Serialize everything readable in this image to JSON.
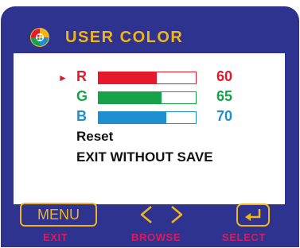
{
  "osd": {
    "title": "USER COLOR",
    "icon": "color-palette-icon"
  },
  "channels": [
    {
      "label": "R",
      "value": "60",
      "fraction": 0.6,
      "color": "#e5192b",
      "selected": true
    },
    {
      "label": "G",
      "value": "65",
      "fraction": 0.65,
      "color": "#17a24a",
      "selected": false
    },
    {
      "label": "B",
      "value": "70",
      "fraction": 0.7,
      "color": "#1e90d0",
      "selected": false
    }
  ],
  "menu_items": {
    "reset": "Reset",
    "exit_without_save": "EXIT WITHOUT SAVE"
  },
  "pointer_glyph": "►",
  "footer": {
    "menu_button": "MENU",
    "exit_label": "EXIT",
    "browse_label": "BROWSE",
    "select_label": "SELECT",
    "browse_icon": "left-right-arrows-icon",
    "select_icon": "enter-return-icon"
  },
  "colors": {
    "frame": "#2e3390",
    "accent": "#f2b418",
    "footer_label": "#d81b5d"
  }
}
